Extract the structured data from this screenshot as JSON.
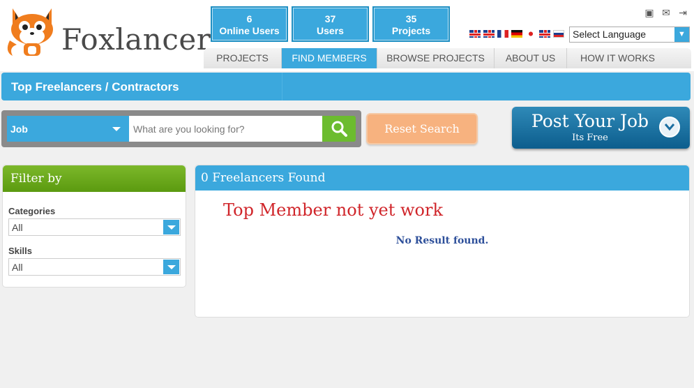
{
  "brand": {
    "name": "Foxlancer"
  },
  "stats": [
    {
      "value": "6",
      "label": "Online Users"
    },
    {
      "value": "37",
      "label": "Users"
    },
    {
      "value": "35",
      "label": "Projects"
    }
  ],
  "language": {
    "selected": "Select Language"
  },
  "nav": {
    "items": [
      {
        "label": "PROJECTS"
      },
      {
        "label": "FIND MEMBERS"
      },
      {
        "label": "BROWSE PROJECTS"
      },
      {
        "label": "ABOUT US"
      },
      {
        "label": "HOW IT WORKS"
      }
    ],
    "active": "FIND MEMBERS"
  },
  "page_title": "Top Freelancers / Contractors",
  "search": {
    "type": "Job",
    "placeholder": "What are you looking for?"
  },
  "reset_label": "Reset Search",
  "post_job": {
    "title": "Post Your Job",
    "subtitle": "Its Free"
  },
  "filter": {
    "title": "Filter by",
    "categories_label": "Categories",
    "categories_value": "All",
    "skills_label": "Skills",
    "skills_value": "All"
  },
  "results": {
    "count_label": "0 Freelancers Found",
    "note": "Top Member not yet work",
    "empty": "No Result found."
  }
}
